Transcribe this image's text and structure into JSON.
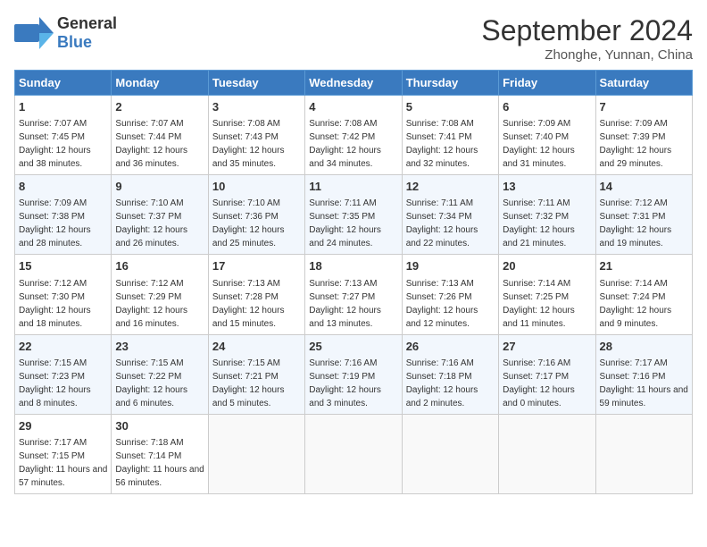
{
  "logo": {
    "text_general": "General",
    "text_blue": "Blue"
  },
  "title": "September 2024",
  "subtitle": "Zhonghe, Yunnan, China",
  "days_of_week": [
    "Sunday",
    "Monday",
    "Tuesday",
    "Wednesday",
    "Thursday",
    "Friday",
    "Saturday"
  ],
  "weeks": [
    [
      {
        "day": 1,
        "sunrise": "7:07 AM",
        "sunset": "7:45 PM",
        "daylight": "12 hours and 38 minutes."
      },
      {
        "day": 2,
        "sunrise": "7:07 AM",
        "sunset": "7:44 PM",
        "daylight": "12 hours and 36 minutes."
      },
      {
        "day": 3,
        "sunrise": "7:08 AM",
        "sunset": "7:43 PM",
        "daylight": "12 hours and 35 minutes."
      },
      {
        "day": 4,
        "sunrise": "7:08 AM",
        "sunset": "7:42 PM",
        "daylight": "12 hours and 34 minutes."
      },
      {
        "day": 5,
        "sunrise": "7:08 AM",
        "sunset": "7:41 PM",
        "daylight": "12 hours and 32 minutes."
      },
      {
        "day": 6,
        "sunrise": "7:09 AM",
        "sunset": "7:40 PM",
        "daylight": "12 hours and 31 minutes."
      },
      {
        "day": 7,
        "sunrise": "7:09 AM",
        "sunset": "7:39 PM",
        "daylight": "12 hours and 29 minutes."
      }
    ],
    [
      {
        "day": 8,
        "sunrise": "7:09 AM",
        "sunset": "7:38 PM",
        "daylight": "12 hours and 28 minutes."
      },
      {
        "day": 9,
        "sunrise": "7:10 AM",
        "sunset": "7:37 PM",
        "daylight": "12 hours and 26 minutes."
      },
      {
        "day": 10,
        "sunrise": "7:10 AM",
        "sunset": "7:36 PM",
        "daylight": "12 hours and 25 minutes."
      },
      {
        "day": 11,
        "sunrise": "7:11 AM",
        "sunset": "7:35 PM",
        "daylight": "12 hours and 24 minutes."
      },
      {
        "day": 12,
        "sunrise": "7:11 AM",
        "sunset": "7:34 PM",
        "daylight": "12 hours and 22 minutes."
      },
      {
        "day": 13,
        "sunrise": "7:11 AM",
        "sunset": "7:32 PM",
        "daylight": "12 hours and 21 minutes."
      },
      {
        "day": 14,
        "sunrise": "7:12 AM",
        "sunset": "7:31 PM",
        "daylight": "12 hours and 19 minutes."
      }
    ],
    [
      {
        "day": 15,
        "sunrise": "7:12 AM",
        "sunset": "7:30 PM",
        "daylight": "12 hours and 18 minutes."
      },
      {
        "day": 16,
        "sunrise": "7:12 AM",
        "sunset": "7:29 PM",
        "daylight": "12 hours and 16 minutes."
      },
      {
        "day": 17,
        "sunrise": "7:13 AM",
        "sunset": "7:28 PM",
        "daylight": "12 hours and 15 minutes."
      },
      {
        "day": 18,
        "sunrise": "7:13 AM",
        "sunset": "7:27 PM",
        "daylight": "12 hours and 13 minutes."
      },
      {
        "day": 19,
        "sunrise": "7:13 AM",
        "sunset": "7:26 PM",
        "daylight": "12 hours and 12 minutes."
      },
      {
        "day": 20,
        "sunrise": "7:14 AM",
        "sunset": "7:25 PM",
        "daylight": "12 hours and 11 minutes."
      },
      {
        "day": 21,
        "sunrise": "7:14 AM",
        "sunset": "7:24 PM",
        "daylight": "12 hours and 9 minutes."
      }
    ],
    [
      {
        "day": 22,
        "sunrise": "7:15 AM",
        "sunset": "7:23 PM",
        "daylight": "12 hours and 8 minutes."
      },
      {
        "day": 23,
        "sunrise": "7:15 AM",
        "sunset": "7:22 PM",
        "daylight": "12 hours and 6 minutes."
      },
      {
        "day": 24,
        "sunrise": "7:15 AM",
        "sunset": "7:21 PM",
        "daylight": "12 hours and 5 minutes."
      },
      {
        "day": 25,
        "sunrise": "7:16 AM",
        "sunset": "7:19 PM",
        "daylight": "12 hours and 3 minutes."
      },
      {
        "day": 26,
        "sunrise": "7:16 AM",
        "sunset": "7:18 PM",
        "daylight": "12 hours and 2 minutes."
      },
      {
        "day": 27,
        "sunrise": "7:16 AM",
        "sunset": "7:17 PM",
        "daylight": "12 hours and 0 minutes."
      },
      {
        "day": 28,
        "sunrise": "7:17 AM",
        "sunset": "7:16 PM",
        "daylight": "11 hours and 59 minutes."
      }
    ],
    [
      {
        "day": 29,
        "sunrise": "7:17 AM",
        "sunset": "7:15 PM",
        "daylight": "11 hours and 57 minutes."
      },
      {
        "day": 30,
        "sunrise": "7:18 AM",
        "sunset": "7:14 PM",
        "daylight": "11 hours and 56 minutes."
      },
      null,
      null,
      null,
      null,
      null
    ]
  ]
}
